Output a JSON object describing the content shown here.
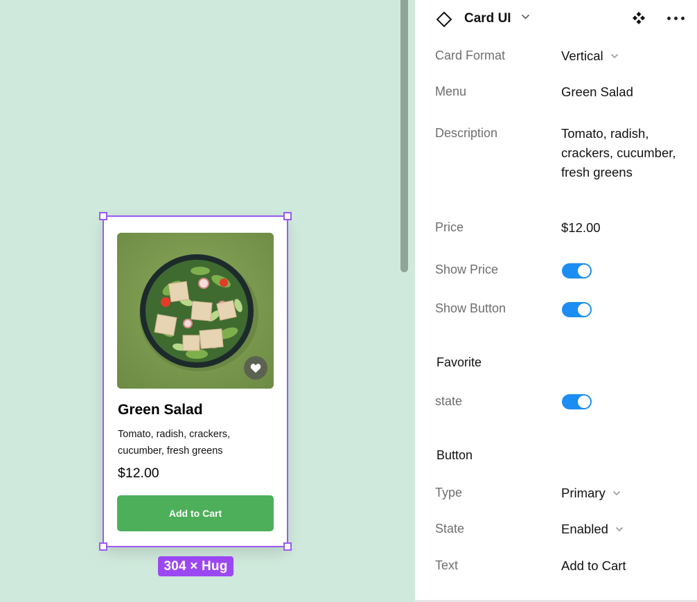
{
  "canvas": {
    "card": {
      "title": "Green Salad",
      "description": "Tomato, radish, crackers, cucumber, fresh greens",
      "price": "$12.00",
      "button_label": "Add to Cart",
      "favorite_icon": "heart-icon"
    },
    "selection": {
      "dimension_label": "304 × Hug"
    }
  },
  "panel": {
    "header": {
      "component_name": "Card UI",
      "icons": [
        "component-icon",
        "chevron-down-icon",
        "variants-icon",
        "more-icon"
      ]
    },
    "properties": [
      {
        "label": "Card Format",
        "value": "Vertical",
        "type": "dropdown"
      },
      {
        "label": "Menu",
        "value": "Green Salad",
        "type": "text"
      },
      {
        "label": "Description",
        "value": "Tomato, radish, crackers, cucumber, fresh greens",
        "type": "text"
      },
      {
        "label": "Price",
        "value": "$12.00",
        "type": "text"
      },
      {
        "label": "Show Price",
        "value": true,
        "type": "toggle"
      },
      {
        "label": "Show Button",
        "value": true,
        "type": "toggle"
      }
    ],
    "favorite": {
      "title": "Favorite",
      "state_label": "state",
      "state_value": true
    },
    "button": {
      "title": "Button",
      "type_label": "Type",
      "type_value": "Primary",
      "state_label": "State",
      "state_value": "Enabled",
      "text_label": "Text",
      "text_value": "Add to Cart"
    }
  },
  "colors": {
    "canvas_bg": "#cfe9dc",
    "selection": "#9b59f5",
    "toggle_on": "#1c8df2",
    "cart_button": "#4eaf5a"
  }
}
